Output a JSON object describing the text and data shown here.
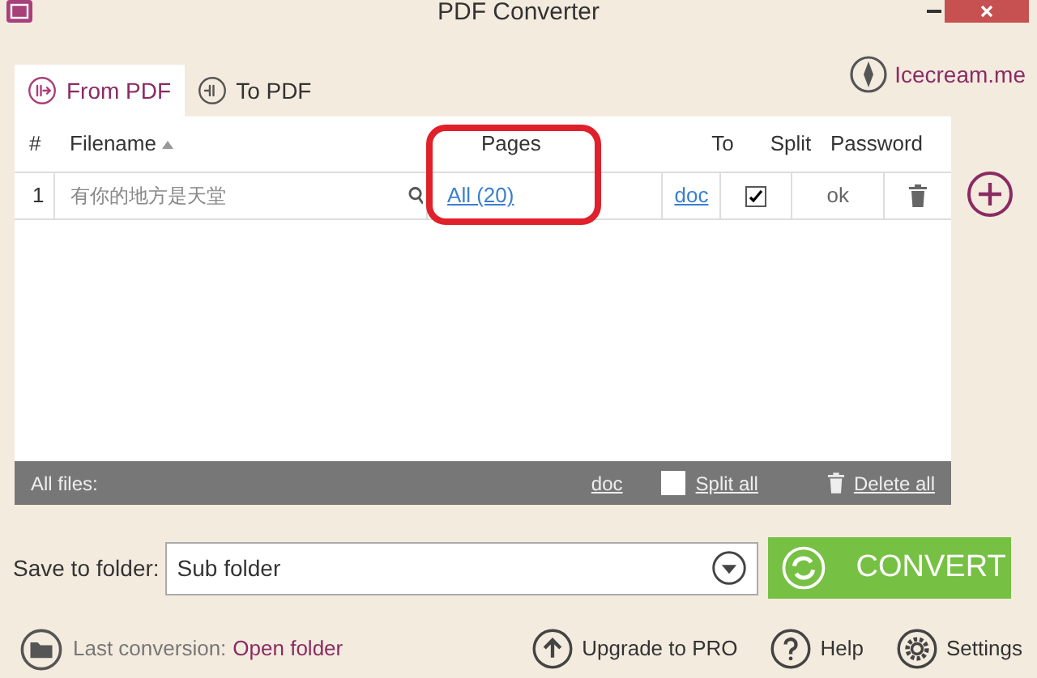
{
  "window": {
    "title": "PDF Converter"
  },
  "tabs": [
    {
      "label": "From PDF",
      "selected": true
    },
    {
      "label": "To PDF",
      "selected": false
    }
  ],
  "brand_link": "Icecream.me",
  "table": {
    "columns": [
      "#",
      "Filename",
      "Pages",
      "To",
      "Split",
      "Password"
    ],
    "rows": [
      {
        "index": "1",
        "filename": "有你的地方是天堂",
        "pages": "All (20)",
        "to": "doc",
        "split": true,
        "password": "ok"
      }
    ]
  },
  "footer": {
    "label": "All files:",
    "format": "doc",
    "split_all": {
      "label": "Split all",
      "checked": false
    },
    "delete_all": "Delete all"
  },
  "save": {
    "label": "Save to folder:",
    "value": "Sub folder"
  },
  "convert_button": "CONVERT",
  "bottom": {
    "last_conversion": "Last conversion:",
    "open_folder": "Open folder",
    "upgrade": "Upgrade to PRO",
    "help": "Help",
    "settings": "Settings"
  }
}
